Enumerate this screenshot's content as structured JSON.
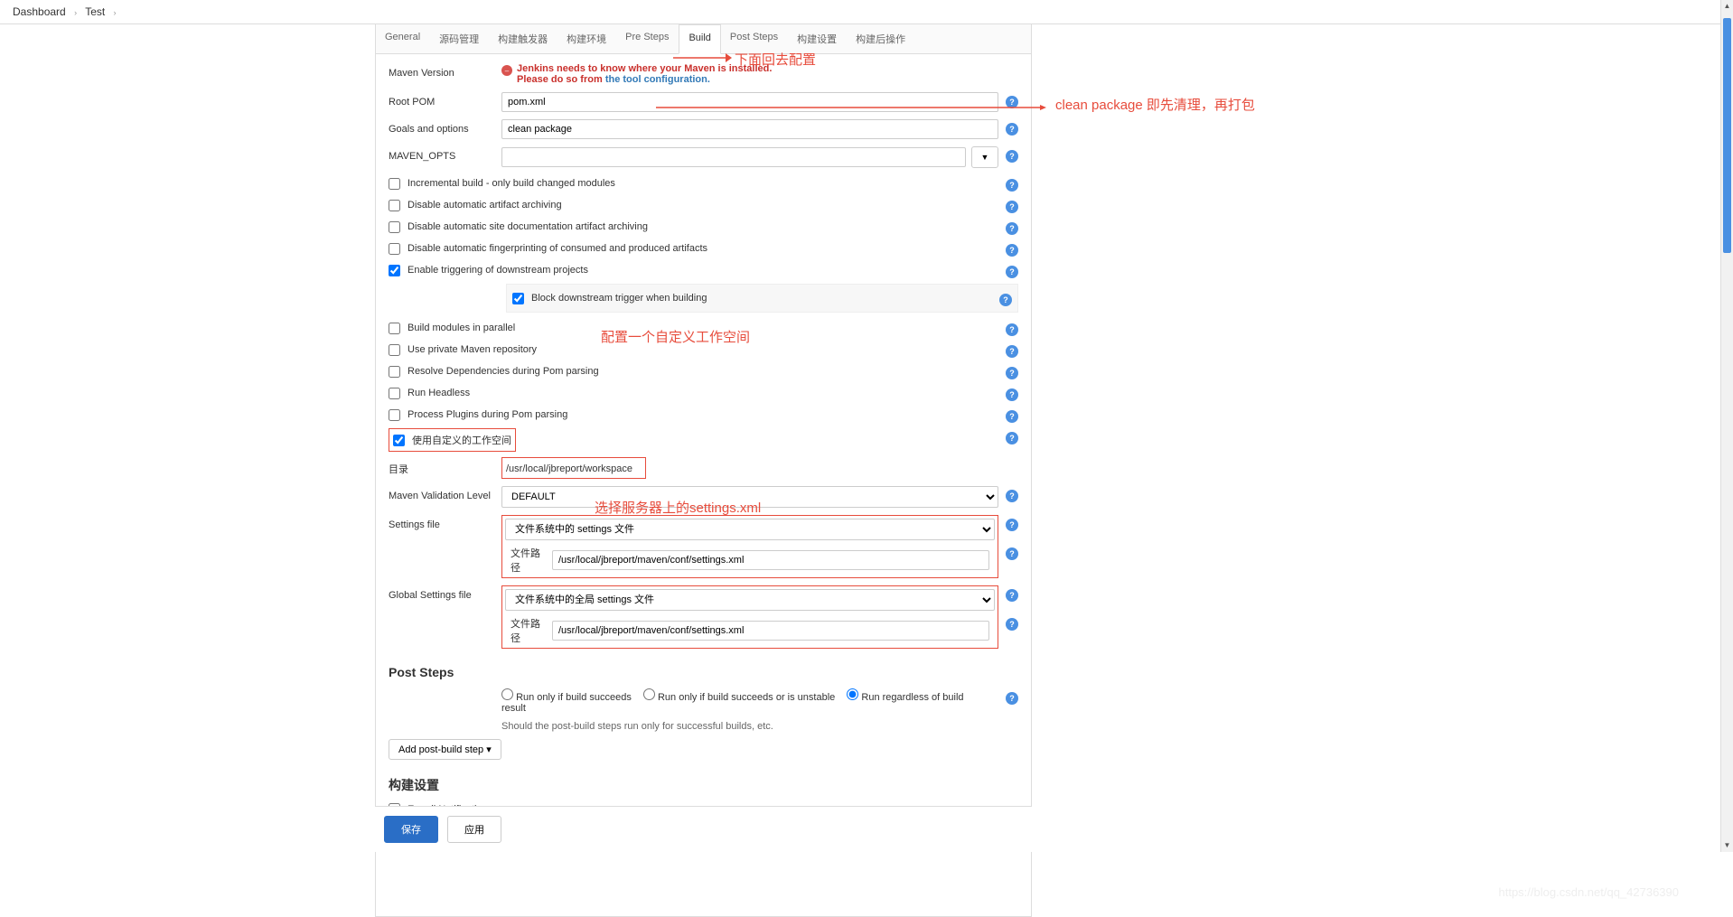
{
  "breadcrumb": {
    "item1": "Dashboard",
    "item2": "Test"
  },
  "tabs": [
    "General",
    "源码管理",
    "构建触发器",
    "构建环境",
    "Pre Steps",
    "Build",
    "Post Steps",
    "构建设置",
    "构建后操作"
  ],
  "labels": {
    "maven_version": "Maven Version",
    "root_pom": "Root POM",
    "goals": "Goals and options",
    "maven_opts": "MAVEN_OPTS",
    "directory": "目录",
    "validation": "Maven Validation Level",
    "settings_file": "Settings file",
    "global_settings": "Global Settings file",
    "file_path": "文件路径"
  },
  "warn": {
    "line1": "Jenkins needs to know where your Maven is installed.",
    "line2_prefix": "Please do so from ",
    "line2_link": "the tool configuration."
  },
  "values": {
    "root_pom": "pom.xml",
    "goals": "clean package",
    "maven_opts": "",
    "directory": "/usr/local/jbreport/workspace",
    "validation": "DEFAULT",
    "settings_select": "文件系统中的 settings 文件",
    "settings_path": "/usr/local/jbreport/maven/conf/settings.xml",
    "global_select": "文件系统中的全局 settings 文件",
    "global_path": "/usr/local/jbreport/maven/conf/settings.xml"
  },
  "checks": {
    "incremental": "Incremental build - only build changed modules",
    "disable_archiving": "Disable automatic artifact archiving",
    "disable_site": "Disable automatic site documentation artifact archiving",
    "disable_fingerprint": "Disable automatic fingerprinting of consumed and produced artifacts",
    "enable_triggering": "Enable triggering of downstream projects",
    "block_downstream": "Block downstream trigger when building",
    "parallel": "Build modules in parallel",
    "private_repo": "Use private Maven repository",
    "resolve_deps": "Resolve Dependencies during Pom parsing",
    "headless": "Run Headless",
    "process_plugins": "Process Plugins during Pom parsing",
    "custom_workspace": "使用自定义的工作空间",
    "email": "E-mail Notification"
  },
  "sections": {
    "post_steps": "Post Steps",
    "build_settings": "构建设置",
    "post_build": "构建后操作"
  },
  "radios": {
    "r1": "Run only if build succeeds",
    "r2": "Run only if build succeeds or is unstable",
    "r3": "Run regardless of build result"
  },
  "post_desc": "Should the post-build steps run only for successful builds, etc.",
  "buttons": {
    "add_post": "Add post-build step ▾",
    "save": "保存",
    "apply": "应用",
    "expand": "▼"
  },
  "annotations": {
    "a1": "下面回去配置",
    "a2": "clean package   即先清理，再打包",
    "a3": "配置一个自定义工作空间",
    "a4": "选择服务器上的settings.xml"
  },
  "watermark": "https://blog.csdn.net/qq_42736390"
}
